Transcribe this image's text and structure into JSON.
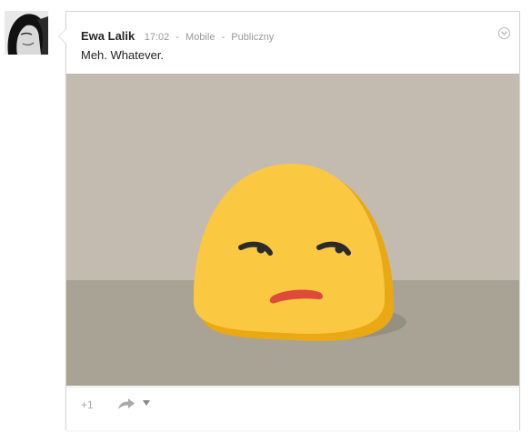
{
  "post": {
    "author": "Ewa Lalik",
    "time": "17:02",
    "separator": "-",
    "source": "Mobile",
    "visibility": "Publiczny",
    "text": "Meh. Whatever."
  },
  "actions": {
    "plus_one": "+1"
  },
  "icons": {
    "menu": "chevron-down-icon",
    "share": "share-arrow-icon",
    "share_menu": "caret-down-icon"
  },
  "colors": {
    "author_text": "#262626",
    "meta_text": "#999999",
    "emoji_face": "#fbc842",
    "emoji_shade": "#e8a915",
    "emoji_mouth": "#dd4b39",
    "wall": "#c4bbb0",
    "floor": "#a8a395"
  }
}
